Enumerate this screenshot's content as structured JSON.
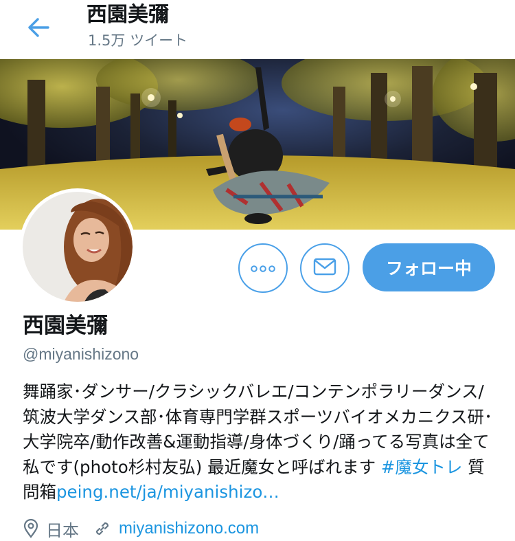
{
  "header": {
    "title": "西園美彌",
    "tweet_count": "1.5万 ツイート"
  },
  "profile": {
    "name": "西園美彌",
    "handle": "@miyanishizono",
    "bio_text": "舞踊家･ダンサー/クラシックバレエ/コンテンポラリーダンス/筑波大学ダンス部･体育専門学群スポーツバイオメカニクス研･大学院卒/動作改善&運動指導/身体づくり/踊ってる写真は全て私です(photo杉村友弘) 最近魔女と呼ばれます ",
    "bio_hashtag": "#魔女トレ",
    "bio_mid": " 質問箱",
    "bio_link": "peing.net/ja/miyanishizo…",
    "location": "日本",
    "website": "miyanishizono.com"
  },
  "actions": {
    "more_icon": "more-dots-icon",
    "message_icon": "envelope-icon",
    "follow_label": "フォロー中"
  },
  "colors": {
    "accent": "#4b9fe6",
    "link": "#1b95e0",
    "secondary_text": "#657786"
  }
}
